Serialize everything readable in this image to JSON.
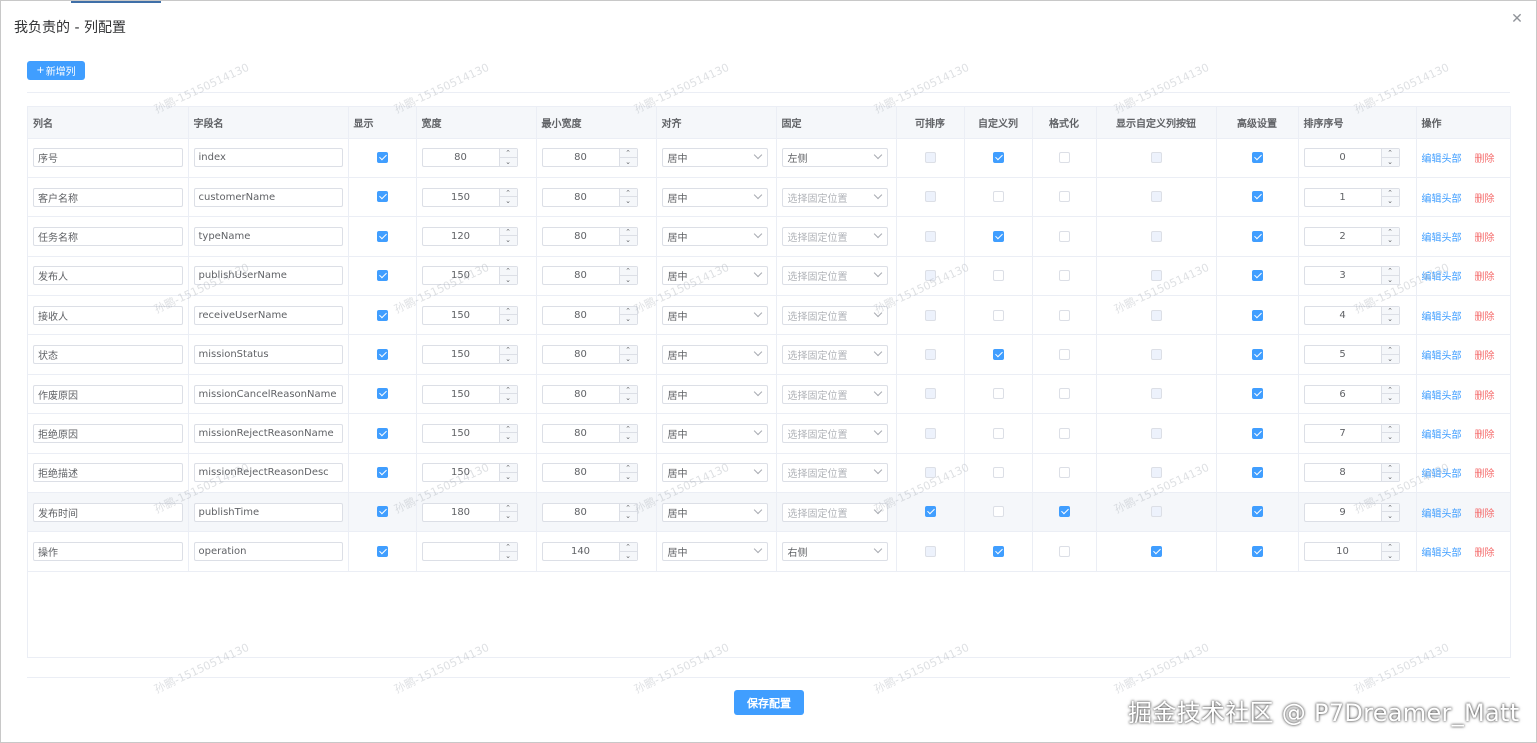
{
  "dialog": {
    "title": "我负责的 - 列配置",
    "close_glyph": "✕"
  },
  "toolbar": {
    "add_plus": "+",
    "add_label": "新增列"
  },
  "table": {
    "headers": [
      "列名",
      "字段名",
      "显示",
      "宽度",
      "最小宽度",
      "对齐",
      "固定",
      "可排序",
      "自定义列",
      "格式化",
      "显示自定义列按钮",
      "高级设置",
      "排序序号",
      "操作"
    ],
    "edit_label": "编辑头部",
    "delete_label": "删除",
    "rows": [
      {
        "label": "序号",
        "prop": "index",
        "show": true,
        "width": "80",
        "minWidth": "80",
        "align": "居中",
        "fixed": "左侧",
        "fixedPlaceholder": false,
        "sortable": false,
        "custom": true,
        "format": false,
        "showCustomBtn": false,
        "advanced": true,
        "order": "0"
      },
      {
        "label": "客户名称",
        "prop": "customerName",
        "show": true,
        "width": "150",
        "minWidth": "80",
        "align": "居中",
        "fixed": "选择固定位置",
        "fixedPlaceholder": true,
        "sortable": false,
        "custom": false,
        "format": false,
        "showCustomBtn": false,
        "advanced": true,
        "order": "1"
      },
      {
        "label": "任务名称",
        "prop": "typeName",
        "show": true,
        "width": "120",
        "minWidth": "80",
        "align": "居中",
        "fixed": "选择固定位置",
        "fixedPlaceholder": true,
        "sortable": false,
        "custom": true,
        "format": false,
        "showCustomBtn": false,
        "advanced": true,
        "order": "2"
      },
      {
        "label": "发布人",
        "prop": "publishUserName",
        "show": true,
        "width": "150",
        "minWidth": "80",
        "align": "居中",
        "fixed": "选择固定位置",
        "fixedPlaceholder": true,
        "sortable": false,
        "custom": false,
        "format": false,
        "showCustomBtn": false,
        "advanced": true,
        "order": "3"
      },
      {
        "label": "接收人",
        "prop": "receiveUserName",
        "show": true,
        "width": "150",
        "minWidth": "80",
        "align": "居中",
        "fixed": "选择固定位置",
        "fixedPlaceholder": true,
        "sortable": false,
        "custom": false,
        "format": false,
        "showCustomBtn": false,
        "advanced": true,
        "order": "4"
      },
      {
        "label": "状态",
        "prop": "missionStatus",
        "show": true,
        "width": "150",
        "minWidth": "80",
        "align": "居中",
        "fixed": "选择固定位置",
        "fixedPlaceholder": true,
        "sortable": false,
        "custom": true,
        "format": false,
        "showCustomBtn": false,
        "advanced": true,
        "order": "5"
      },
      {
        "label": "作废原因",
        "prop": "missionCancelReasonName",
        "show": true,
        "width": "150",
        "minWidth": "80",
        "align": "居中",
        "fixed": "选择固定位置",
        "fixedPlaceholder": true,
        "sortable": false,
        "custom": false,
        "format": false,
        "showCustomBtn": false,
        "advanced": true,
        "order": "6"
      },
      {
        "label": "拒绝原因",
        "prop": "missionRejectReasonName",
        "show": true,
        "width": "150",
        "minWidth": "80",
        "align": "居中",
        "fixed": "选择固定位置",
        "fixedPlaceholder": true,
        "sortable": false,
        "custom": false,
        "format": false,
        "showCustomBtn": false,
        "advanced": true,
        "order": "7"
      },
      {
        "label": "拒绝描述",
        "prop": "missionRejectReasonDesc",
        "show": true,
        "width": "150",
        "minWidth": "80",
        "align": "居中",
        "fixed": "选择固定位置",
        "fixedPlaceholder": true,
        "sortable": false,
        "custom": false,
        "format": false,
        "showCustomBtn": false,
        "advanced": true,
        "order": "8"
      },
      {
        "label": "发布时间",
        "prop": "publishTime",
        "show": true,
        "width": "180",
        "minWidth": "80",
        "align": "居中",
        "fixed": "选择固定位置",
        "fixedPlaceholder": true,
        "sortable": true,
        "custom": false,
        "format": true,
        "showCustomBtn": false,
        "advanced": true,
        "order": "9"
      },
      {
        "label": "操作",
        "prop": "operation",
        "show": true,
        "width": "",
        "minWidth": "140",
        "align": "居中",
        "fixed": "右侧",
        "fixedPlaceholder": false,
        "sortable": false,
        "custom": true,
        "format": false,
        "showCustomBtn": true,
        "advanced": true,
        "order": "10"
      }
    ]
  },
  "footer": {
    "save_label": "保存配置"
  },
  "watermark": {
    "tile_text": "孙鹏-15150514130",
    "corner_text": "掘金技术社区 @ P7Dreamer_Matt"
  },
  "colors": {
    "primary": "#409eff",
    "danger": "#f56c6c",
    "header_bg": "#f5f7fa",
    "border": "#ebeef5"
  }
}
